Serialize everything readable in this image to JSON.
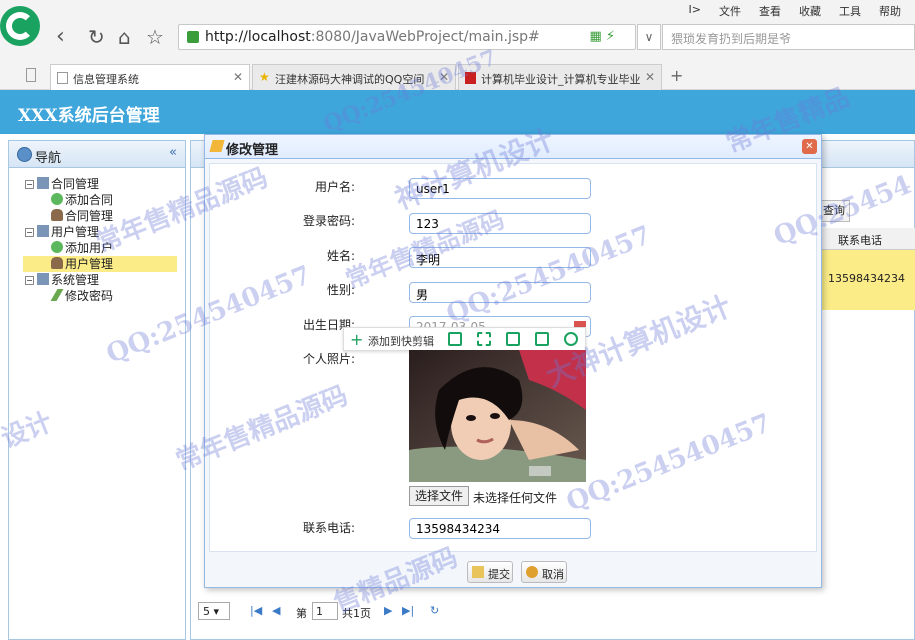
{
  "browser": {
    "menu": [
      "I>",
      "文件",
      "查看",
      "收藏",
      "工具",
      "帮助"
    ],
    "url_host": "http://localhost",
    "url_rest": ":8080/JavaWebProject/main.jsp#",
    "search_placeholder": "猥琐发育扔到后期是爷",
    "tabs": [
      {
        "label": "信息管理系统"
      },
      {
        "label": "汪建林源码大神调试的QQ空间"
      },
      {
        "label": "计算机毕业设计_计算机专业毕业"
      }
    ],
    "new_tab": "+"
  },
  "app": {
    "title": "XXX系统后台管理",
    "nav_title": "导航",
    "tree": [
      {
        "label": "合同管理",
        "level": 0,
        "box": "−"
      },
      {
        "label": "添加合同",
        "level": 1
      },
      {
        "label": "合同管理",
        "level": 1
      },
      {
        "label": "用户管理",
        "level": 0,
        "box": "−"
      },
      {
        "label": "添加用户",
        "level": 1
      },
      {
        "label": "用户管理",
        "level": 1,
        "selected": true
      },
      {
        "label": "系统管理",
        "level": 0,
        "box": "−"
      },
      {
        "label": "修改密码",
        "level": 1
      }
    ],
    "query_button": "查询",
    "column_phone": "联系电话",
    "row_phone": "13598434234",
    "pager": {
      "size": "5",
      "page_prefix": "第",
      "page": "1",
      "total": "共1页"
    }
  },
  "modal": {
    "title": "修改管理",
    "labels": {
      "username": "用户名:",
      "password": "登录密码:",
      "name": "姓名:",
      "gender": "性别:",
      "birthday": "出生日期:",
      "photo": "个人照片:",
      "phone": "联系电话:"
    },
    "values": {
      "username": "user1",
      "password": "123",
      "name": "李明",
      "gender": "男",
      "birthday": "2017-03-05",
      "phone": "13598434234"
    },
    "clip_toolbar": "添加到快剪辑",
    "file_button": "选择文件",
    "file_status": "未选择任何文件",
    "submit": "提交",
    "cancel": "取消"
  },
  "watermarks": [
    "QQ:254540457",
    "QQ:254540457",
    "QQ:254540457",
    "QQ:254540457",
    "QQ:25454",
    "神计算机设计",
    "大神计算机设计",
    "常年售精品源码",
    "常年售精品源码",
    "售精品源码",
    "常年售精品",
    "设计",
    "常年售精品源码"
  ]
}
